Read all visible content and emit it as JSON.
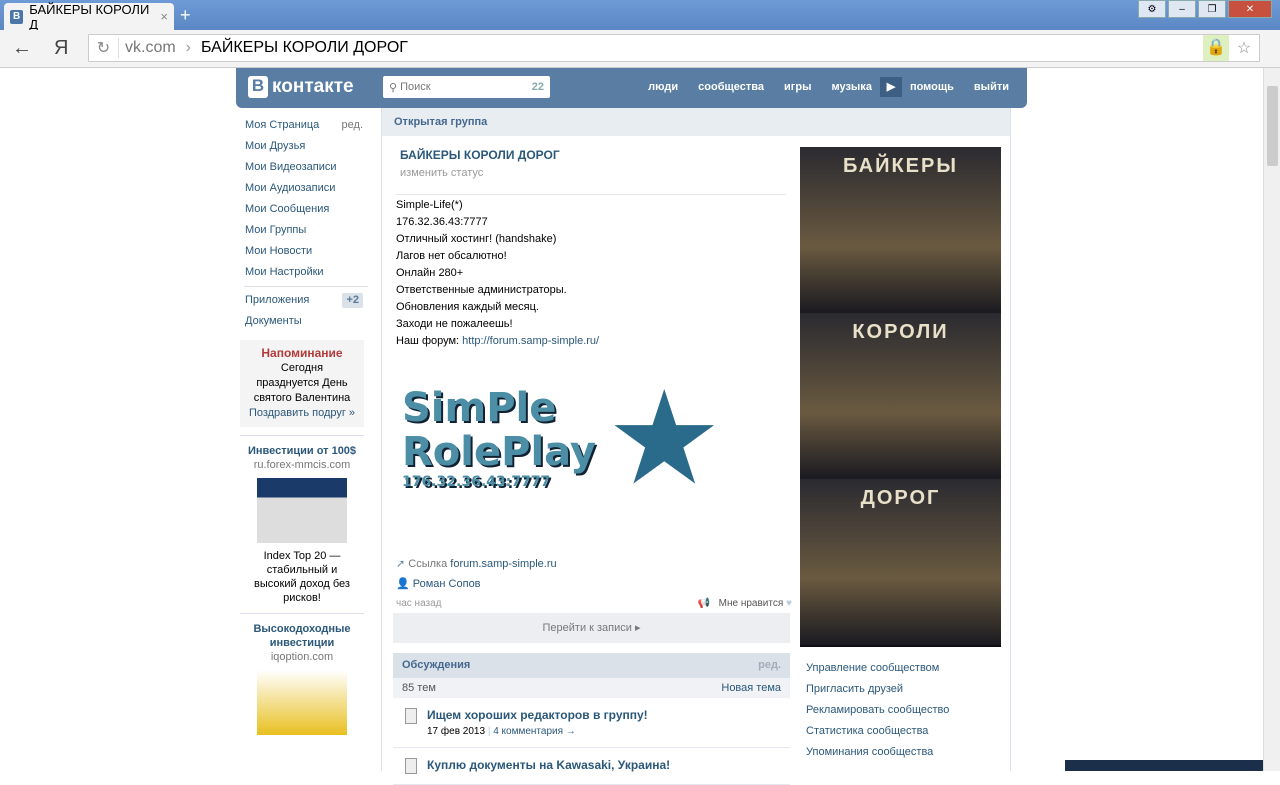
{
  "browser": {
    "tab_title": "БАЙКЕРЫ КОРОЛИ Д",
    "tab_favicon": "В",
    "url_domain": "vk.com",
    "url_title": "БАЙКЕРЫ КОРОЛИ ДОРОГ",
    "yandex": "Я"
  },
  "header": {
    "logo_b": "В",
    "logo_text": "контакте",
    "search_placeholder": "Поиск",
    "search_count": "22",
    "nav": [
      "люди",
      "сообщества",
      "игры",
      "музыка",
      "помощь",
      "выйти"
    ]
  },
  "sidebar": {
    "items": [
      "Моя Страница",
      "Мои Друзья",
      "Мои Видеозаписи",
      "Мои Аудиозаписи",
      "Мои Сообщения",
      "Мои Группы",
      "Мои Новости",
      "Мои Настройки"
    ],
    "edit": "ред.",
    "apps": "Приложения",
    "apps_badge": "+2",
    "docs": "Документы",
    "reminder": {
      "title": "Напоминание",
      "text": "Сегодня празднуется День святого Валентина",
      "link": "Поздравить подруг »"
    },
    "ad1": {
      "title": "Инвестиции от 100$",
      "domain": "ru.forex-mmcis.com",
      "text": "Index Top 20 — стабильный и высокий доход без рисков!"
    },
    "ad2": {
      "title": "Высокодоходные инвестиции",
      "domain": "iqoption.com"
    }
  },
  "group": {
    "type": "Открытая группа",
    "name": "БАЙКЕРЫ КОРОЛИ ДОРОГ",
    "status": "изменить статус",
    "desc": [
      "Simple-Life(*)",
      "176.32.36.43:7777",
      "Отличный хостинг! (handshake)",
      "Лагов нет обсалютно!",
      "Онлайн 280+",
      "Ответственные администраторы.",
      "Обновления каждый месяц.",
      "Заходи не пожалеешь!"
    ],
    "forum_label": "Наш форум: ",
    "forum_url": "http://forum.samp-simple.ru/",
    "image": {
      "line1": "SimPle",
      "line2": "RolePlay",
      "ip": "176.32.36.43:7777"
    },
    "cover": [
      "БАЙКЕРЫ",
      "КОРОЛИ",
      "ДОРОГ"
    ],
    "link_label": "Ссылка ",
    "link_url": "forum.samp-simple.ru",
    "author": "Роман Сопов",
    "time": "час назад",
    "like": "Мне нравится",
    "goto": "Перейти к записи ▸",
    "discussions": {
      "title": "Обсуждения",
      "edit": "ред.",
      "count": "85 тем",
      "new": "Новая тема",
      "topics": [
        {
          "title": "Ищем хороших редакторов в группу!",
          "date": "17 фев 2013",
          "comments": "4 комментария →"
        },
        {
          "title": "Куплю документы на Kawasaki, Украина!"
        }
      ]
    },
    "manage": [
      "Управление сообществом",
      "Пригласить друзей",
      "Рекламировать сообщество",
      "Статистика сообщества",
      "Упоминания сообщества"
    ]
  }
}
